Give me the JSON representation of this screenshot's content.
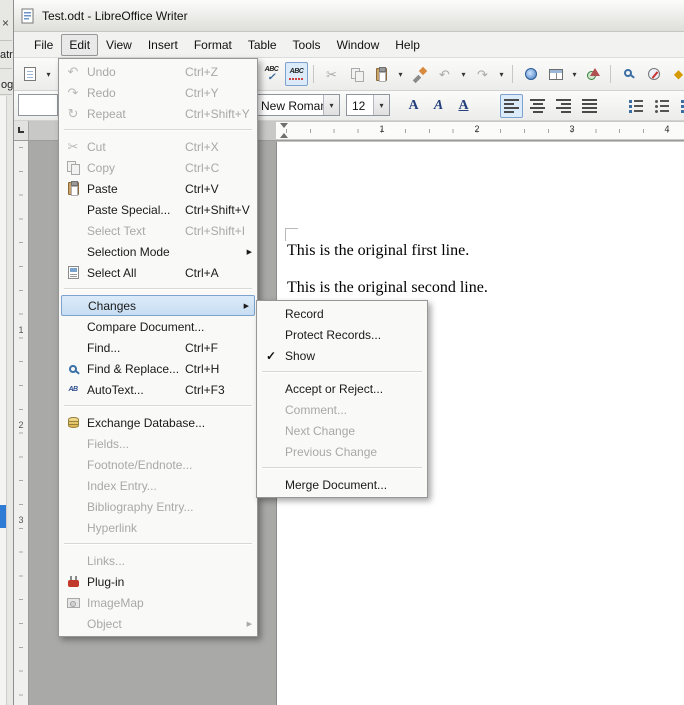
{
  "background_strip": {
    "close": "×",
    "fragments": [
      "atr",
      "og"
    ]
  },
  "window": {
    "title": "Test.odt - LibreOffice Writer"
  },
  "menubar": {
    "items": [
      "File",
      "Edit",
      "View",
      "Insert",
      "Format",
      "Table",
      "Tools",
      "Window",
      "Help"
    ]
  },
  "icons": {
    "undo": "↶",
    "redo": "↷",
    "repeat": "↻",
    "cut": "✂",
    "check": "✓",
    "dropdown": "▾",
    "submenu_arrow": "▶",
    "gallery": "◆",
    "pilcrow": "¶",
    "spell_abc": "ABC",
    "autotext": "AB",
    "format_a": "A"
  },
  "toolbars": {
    "formatting": {
      "font_name": "New Roman",
      "font_size": "12"
    }
  },
  "ruler": {
    "horizontal_numbers": [
      "1",
      "2",
      "3",
      "4"
    ],
    "vertical_numbers": [
      "1",
      "2",
      "3"
    ]
  },
  "edit_menu": {
    "items": [
      {
        "label": "Undo",
        "shortcut": "Ctrl+Z",
        "enabled": false
      },
      {
        "label": "Redo",
        "shortcut": "Ctrl+Y",
        "enabled": false
      },
      {
        "label": "Repeat",
        "shortcut": "Ctrl+Shift+Y",
        "enabled": false
      },
      {
        "separator": true
      },
      {
        "label": "Cut",
        "shortcut": "Ctrl+X",
        "enabled": false
      },
      {
        "label": "Copy",
        "shortcut": "Ctrl+C",
        "enabled": false
      },
      {
        "label": "Paste",
        "shortcut": "Ctrl+V",
        "enabled": true
      },
      {
        "label": "Paste Special...",
        "shortcut": "Ctrl+Shift+V",
        "enabled": true
      },
      {
        "label": "Select Text",
        "shortcut": "Ctrl+Shift+I",
        "enabled": false
      },
      {
        "label": "Selection Mode",
        "submenu": true,
        "enabled": true
      },
      {
        "label": "Select All",
        "shortcut": "Ctrl+A",
        "enabled": true
      },
      {
        "separator": true
      },
      {
        "label": "Changes",
        "submenu": true,
        "enabled": true,
        "highlighted": true
      },
      {
        "label": "Compare Document...",
        "enabled": true
      },
      {
        "label": "Find...",
        "shortcut": "Ctrl+F",
        "enabled": true
      },
      {
        "label": "Find & Replace...",
        "shortcut": "Ctrl+H",
        "enabled": true
      },
      {
        "label": "AutoText...",
        "shortcut": "Ctrl+F3",
        "enabled": true
      },
      {
        "separator": true
      },
      {
        "label": "Exchange Database...",
        "enabled": true
      },
      {
        "label": "Fields...",
        "enabled": false
      },
      {
        "label": "Footnote/Endnote...",
        "enabled": false
      },
      {
        "label": "Index Entry...",
        "enabled": false
      },
      {
        "label": "Bibliography Entry...",
        "enabled": false
      },
      {
        "label": "Hyperlink",
        "enabled": false
      },
      {
        "separator": true
      },
      {
        "label": "Links...",
        "enabled": false
      },
      {
        "label": "Plug-in",
        "enabled": true
      },
      {
        "label": "ImageMap",
        "enabled": false
      },
      {
        "label": "Object",
        "submenu": true,
        "enabled": false
      }
    ]
  },
  "changes_submenu": {
    "items": [
      {
        "label": "Record",
        "enabled": true
      },
      {
        "label": "Protect Records...",
        "enabled": true
      },
      {
        "label": "Show",
        "enabled": true,
        "checked": true
      },
      {
        "separator": true
      },
      {
        "label": "Accept or Reject...",
        "enabled": true
      },
      {
        "label": "Comment...",
        "enabled": false
      },
      {
        "label": "Next Change",
        "enabled": false
      },
      {
        "label": "Previous Change",
        "enabled": false
      },
      {
        "separator": true
      },
      {
        "label": "Merge Document...",
        "enabled": true
      }
    ]
  },
  "document": {
    "lines": [
      "This is the original first line.",
      "This is the original second line."
    ]
  },
  "colors": {
    "menu_highlight_fill": "#d5e6f7",
    "menu_highlight_border": "#7da2ce",
    "gallery_gold": "#d69b00",
    "plugin_red": "#c0392b"
  }
}
